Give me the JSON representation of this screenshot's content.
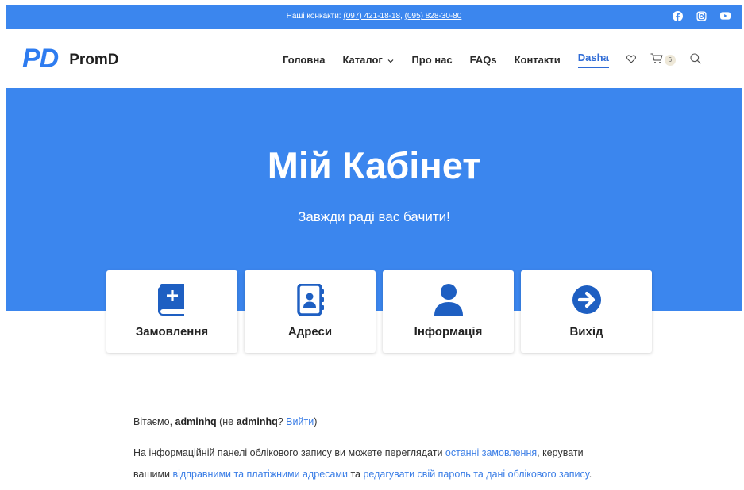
{
  "topbar": {
    "contacts_label": "Наші конкакти:",
    "phone1": "(097) 421-18-18",
    "sep": ",",
    "phone2": "(095) 828-30-80",
    "socials": [
      "facebook-icon",
      "instagram-icon",
      "youtube-icon"
    ]
  },
  "header": {
    "logo_mark": "PD",
    "logo_name": "PromD",
    "nav": {
      "home": "Головна",
      "catalog": "Каталог",
      "about": "Про нас",
      "faqs": "FAQs",
      "contacts": "Контакти",
      "user": "Dasha"
    },
    "cart_count": "6"
  },
  "hero": {
    "title": "Мій Кабінет",
    "subtitle": "Завжди раді вас бачити!"
  },
  "cards": {
    "orders": "Замовлення",
    "addresses": "Адреси",
    "info": "Інформація",
    "logout": "Вихід"
  },
  "content": {
    "greeting_prefix": "Вітаємо,",
    "username": "adminhq",
    "not_prefix": "(не",
    "not_user": "adminhq",
    "question": "?",
    "logout_link": "Вийти",
    "close_paren": ")",
    "line2_prefix": "На інформаційній панелі облікового запису ви можете переглядати",
    "recent_orders_link": "останні замовлення",
    "line2_mid": ", керувати",
    "line3_prefix": "вашими",
    "addresses_link": "відправними та платіжними адресами",
    "line3_mid": "та",
    "edit_link": "редагувати свій пароль та дані облікового запису",
    "line3_end": "."
  },
  "colors": {
    "brand_blue": "#3b86ee",
    "icon_blue": "#1e5fc2",
    "link_blue": "#3b7ee6"
  }
}
